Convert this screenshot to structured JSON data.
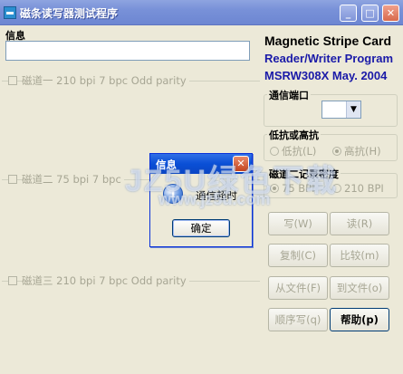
{
  "window": {
    "title": "磁条读写器测试程序",
    "minimize_glyph": "_",
    "maximize_glyph": "□",
    "close_glyph": "✕"
  },
  "info": {
    "label": "信息",
    "value": ""
  },
  "tracks": [
    {
      "label": "磁道一 210 bpi 7 bpc  Odd parity",
      "checked": false
    },
    {
      "label": "磁道二  75 bpi 7 bpc",
      "checked": false
    },
    {
      "label": "磁道三 210 bpi 7 bpc  Odd parity",
      "checked": false
    }
  ],
  "product": {
    "line1": "Magnetic Stripe Card",
    "line2": "Reader/Writer Program",
    "line3": "MSRW308X May. 2004"
  },
  "port_group": {
    "label": "通信端口",
    "selected": ""
  },
  "coercivity_group": {
    "label": "低抗或高抗",
    "options": [
      "低抗(L)",
      "高抗(H)"
    ],
    "selected": "高抗(H)"
  },
  "density_group": {
    "label": "磁道二记录密度",
    "options": [
      "75 BPI",
      "210 BPI"
    ],
    "selected": "75 BPI"
  },
  "buttons": {
    "write": "写(W)",
    "read": "读(R)",
    "copy": "复制(C)",
    "compare": "比较(m)",
    "from_file": "从文件(F)",
    "to_file": "到文件(o)",
    "sequential_write": "顺序写(q)",
    "help": "帮助(p)"
  },
  "dialog": {
    "title": "信息",
    "icon": "info-icon",
    "message": "通信超时",
    "ok_label": "确定"
  },
  "watermark": {
    "line1": "JZ5U绿色下载",
    "line2": "www.jz5u.com"
  },
  "colors": {
    "titlebar": "#7891d8",
    "dialog_titlebar": "#0a4fd6",
    "disabled_text": "#a7a694",
    "product_blue": "#1a1aa8"
  }
}
